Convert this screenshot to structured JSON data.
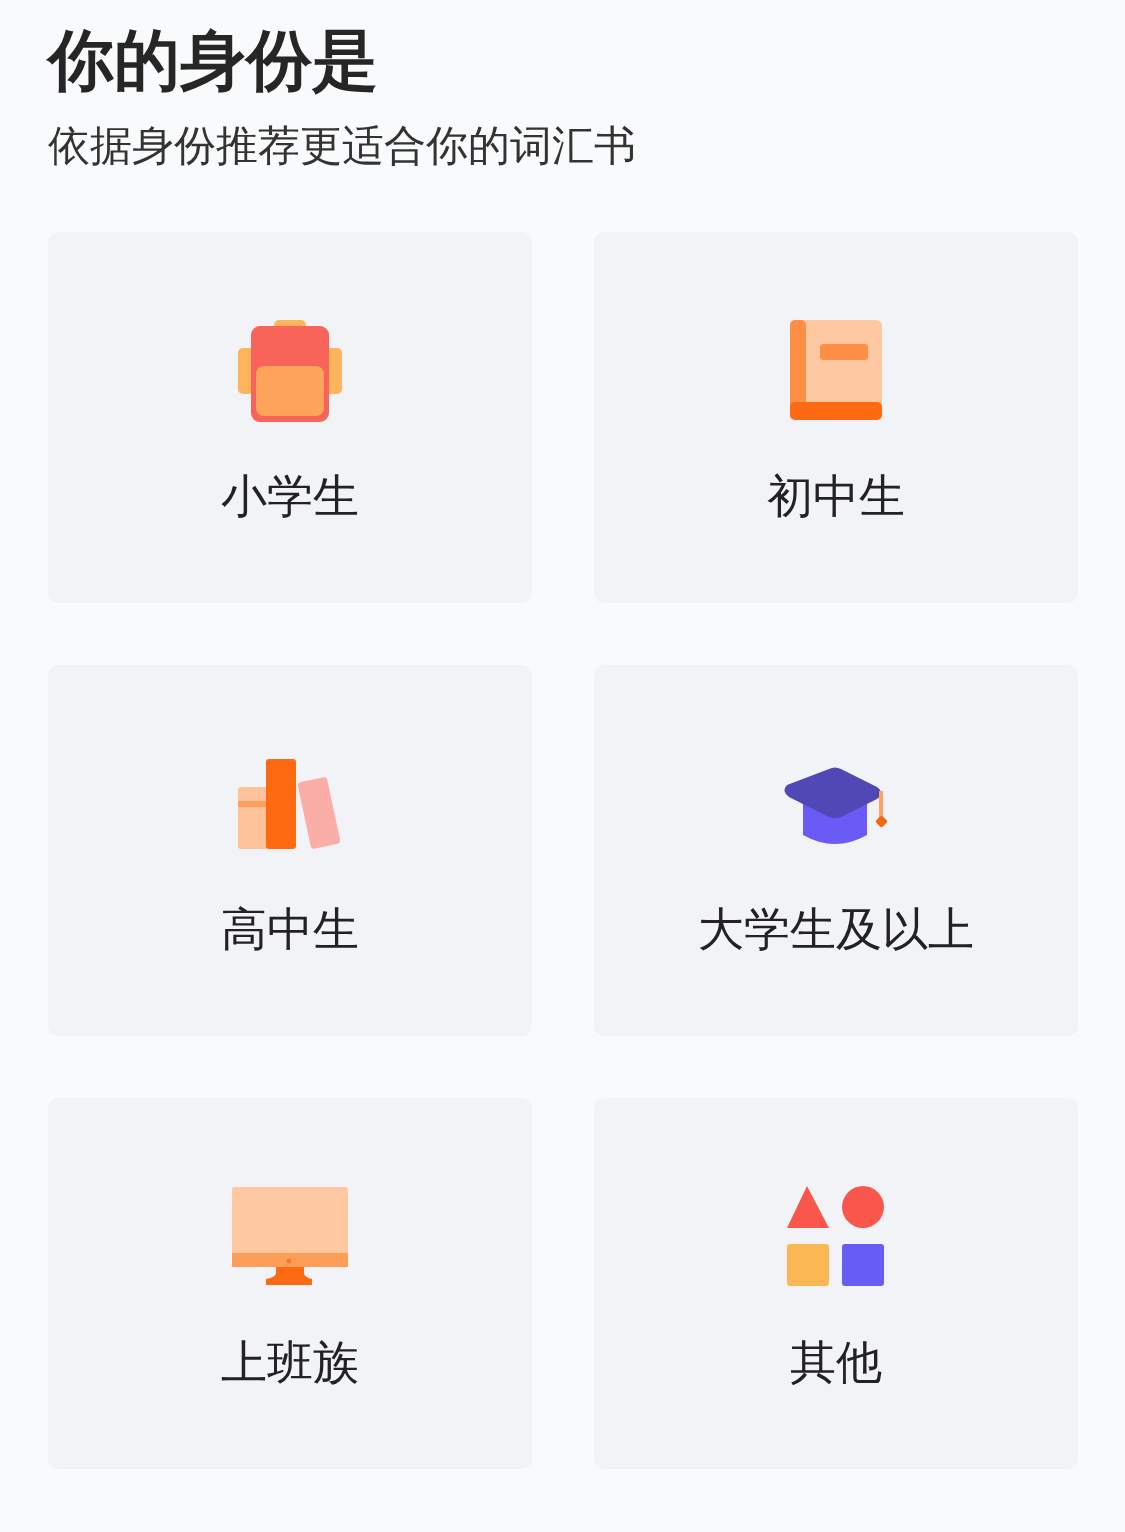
{
  "title": "你的身份是",
  "subtitle": "依据身份推荐更适合你的词汇书",
  "options": [
    {
      "kind": "backpack",
      "label": "小学生"
    },
    {
      "kind": "book",
      "label": "初中生"
    },
    {
      "kind": "books",
      "label": "高中生"
    },
    {
      "kind": "cap",
      "label": "大学生及以上"
    },
    {
      "kind": "monitor",
      "label": "上班族"
    },
    {
      "kind": "shapes",
      "label": "其他"
    }
  ]
}
